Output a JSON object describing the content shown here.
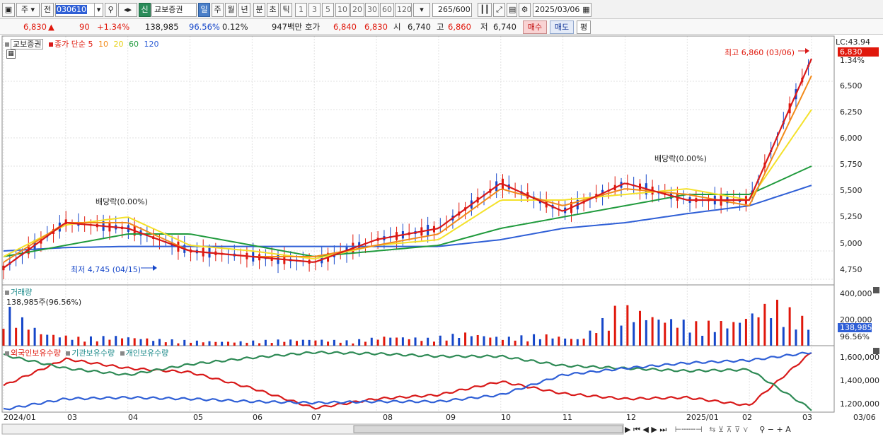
{
  "toolbar": {
    "type_label": "주",
    "prev_label": "전",
    "code": "030610",
    "badge": "신",
    "stock_name": "교보증권",
    "periods": [
      "일",
      "주",
      "월",
      "년",
      "분",
      "초",
      "틱"
    ],
    "selected_period": "일",
    "numbers": [
      "1",
      "3",
      "5",
      "10",
      "20",
      "30",
      "60",
      "120"
    ],
    "count": "265",
    "count_max": "/600",
    "date": "2025/03/06"
  },
  "quote": {
    "price": "6,830",
    "arrow": "▲",
    "change": "90",
    "change_pct": "+1.34%",
    "volume": "138,985",
    "vol_ratio": "96.56%",
    "turnover_pct": "0.12%",
    "amount": "947백만",
    "hoga_label": "호가",
    "ask": "6,840",
    "bid": "6,830",
    "open_label": "시",
    "open": "6,740",
    "high_label": "고",
    "high": "6,860",
    "low_label": "저",
    "low": "6,740",
    "buy_button": "매수",
    "sell_button": "매도",
    "eval_button": "평"
  },
  "price_panel": {
    "name_tag": "교보증권",
    "ma_label": "종가 단순",
    "ma_periods": [
      "5",
      "10",
      "20",
      "60",
      "120"
    ],
    "ma_colors": [
      "#d81919",
      "#f28a1a",
      "#f4e12a",
      "#1f9a3c",
      "#2f5fd6"
    ],
    "lc_label": "LC:43.94",
    "last_price": "6,830",
    "last_pct": "1.34%",
    "high_note": "최고 6,860 (03/06)",
    "low_note": "최저 4,745 (04/15)",
    "div_note_1": "배당락(0.00%)",
    "div_note_2": "배당락(0.00%)",
    "y_ticks": [
      "6,500",
      "6,250",
      "6,000",
      "5,750",
      "5,500",
      "5,250",
      "5,000",
      "4,750"
    ]
  },
  "volume_panel": {
    "title": "거래량",
    "value_note": "138,985주(96.56%)",
    "y_ticks": [
      "400,000",
      "200,000"
    ],
    "last_value": "138,985",
    "last_pct": "96.56%"
  },
  "holdings_panel": {
    "series": [
      "외국인보유수량",
      "기관보유수량",
      "개인보유수량"
    ],
    "y_ticks": [
      "1,600,000",
      "1,400,000",
      "1,200,000"
    ]
  },
  "x_axis": {
    "labels": [
      "2024/01",
      "03",
      "04",
      "05",
      "06",
      "07",
      "08",
      "09",
      "10",
      "11",
      "12",
      "2025/01",
      "02",
      "03",
      "03/06"
    ]
  },
  "chart_data": [
    {
      "type": "line",
      "title": "교보증권",
      "series_names": [
        "5",
        "10",
        "20",
        "60",
        "120"
      ],
      "x": [
        "2024/01",
        "03",
        "04",
        "05",
        "06",
        "07",
        "08",
        "09",
        "10",
        "11",
        "12",
        "2025/01",
        "02",
        "03"
      ],
      "series": [
        {
          "name": "5",
          "values": [
            4850,
            5250,
            5200,
            5000,
            4950,
            4900,
            5100,
            5200,
            5600,
            5350,
            5600,
            5450,
            5450,
            6700
          ]
        },
        {
          "name": "10",
          "values": [
            4900,
            5250,
            5250,
            5000,
            4950,
            4950,
            5050,
            5150,
            5550,
            5400,
            5550,
            5500,
            5400,
            6550
          ]
        },
        {
          "name": "20",
          "values": [
            4950,
            5230,
            5300,
            5050,
            5000,
            4930,
            5050,
            5100,
            5450,
            5450,
            5500,
            5550,
            5450,
            6250
          ]
        },
        {
          "name": "60",
          "values": [
            4950,
            5050,
            5150,
            5150,
            5050,
            4950,
            5000,
            5050,
            5200,
            5300,
            5400,
            5500,
            5500,
            5750
          ]
        },
        {
          "name": "120",
          "values": [
            5000,
            5030,
            5040,
            5040,
            5040,
            5040,
            5040,
            5040,
            5100,
            5200,
            5250,
            5330,
            5400,
            5580
          ]
        }
      ],
      "ylim": [
        4700,
        6900
      ],
      "ylabel": ""
    },
    {
      "type": "bar",
      "title": "거래량",
      "ylim": [
        0,
        450000
      ],
      "values": [
        250000,
        80000,
        50000,
        60000,
        40000,
        30000,
        25000,
        35000,
        40000,
        30000,
        60000,
        45000,
        80000,
        50000,
        70000,
        40000,
        250000,
        180000,
        140000,
        150000,
        280000,
        138985
      ]
    },
    {
      "type": "line",
      "title": "외국인보유수량",
      "x": [
        "2024/01",
        "03",
        "04",
        "05",
        "06",
        "07",
        "08",
        "09",
        "10",
        "11",
        "12",
        "2025/01",
        "02",
        "03"
      ],
      "series": [
        {
          "name": "외국인보유수량",
          "values": [
            1350000,
            1550000,
            1480000,
            1450000,
            1330000,
            1180000,
            1250000,
            1280000,
            1380000,
            1290000,
            1250000,
            1260000,
            1200000,
            1600000
          ]
        },
        {
          "name": "기관보유수량",
          "values": [
            1580000,
            1480000,
            1430000,
            1510000,
            1560000,
            1600000,
            1590000,
            1570000,
            1570000,
            1500000,
            1480000,
            1460000,
            1470000,
            1170000
          ]
        },
        {
          "name": "개인보유수량",
          "values": [
            1170000,
            1250000,
            1260000,
            1250000,
            1230000,
            1220000,
            1230000,
            1230000,
            1280000,
            1430000,
            1480000,
            1520000,
            1540000,
            1600000
          ]
        }
      ],
      "ylim": [
        1150000,
        1650000
      ]
    }
  ]
}
